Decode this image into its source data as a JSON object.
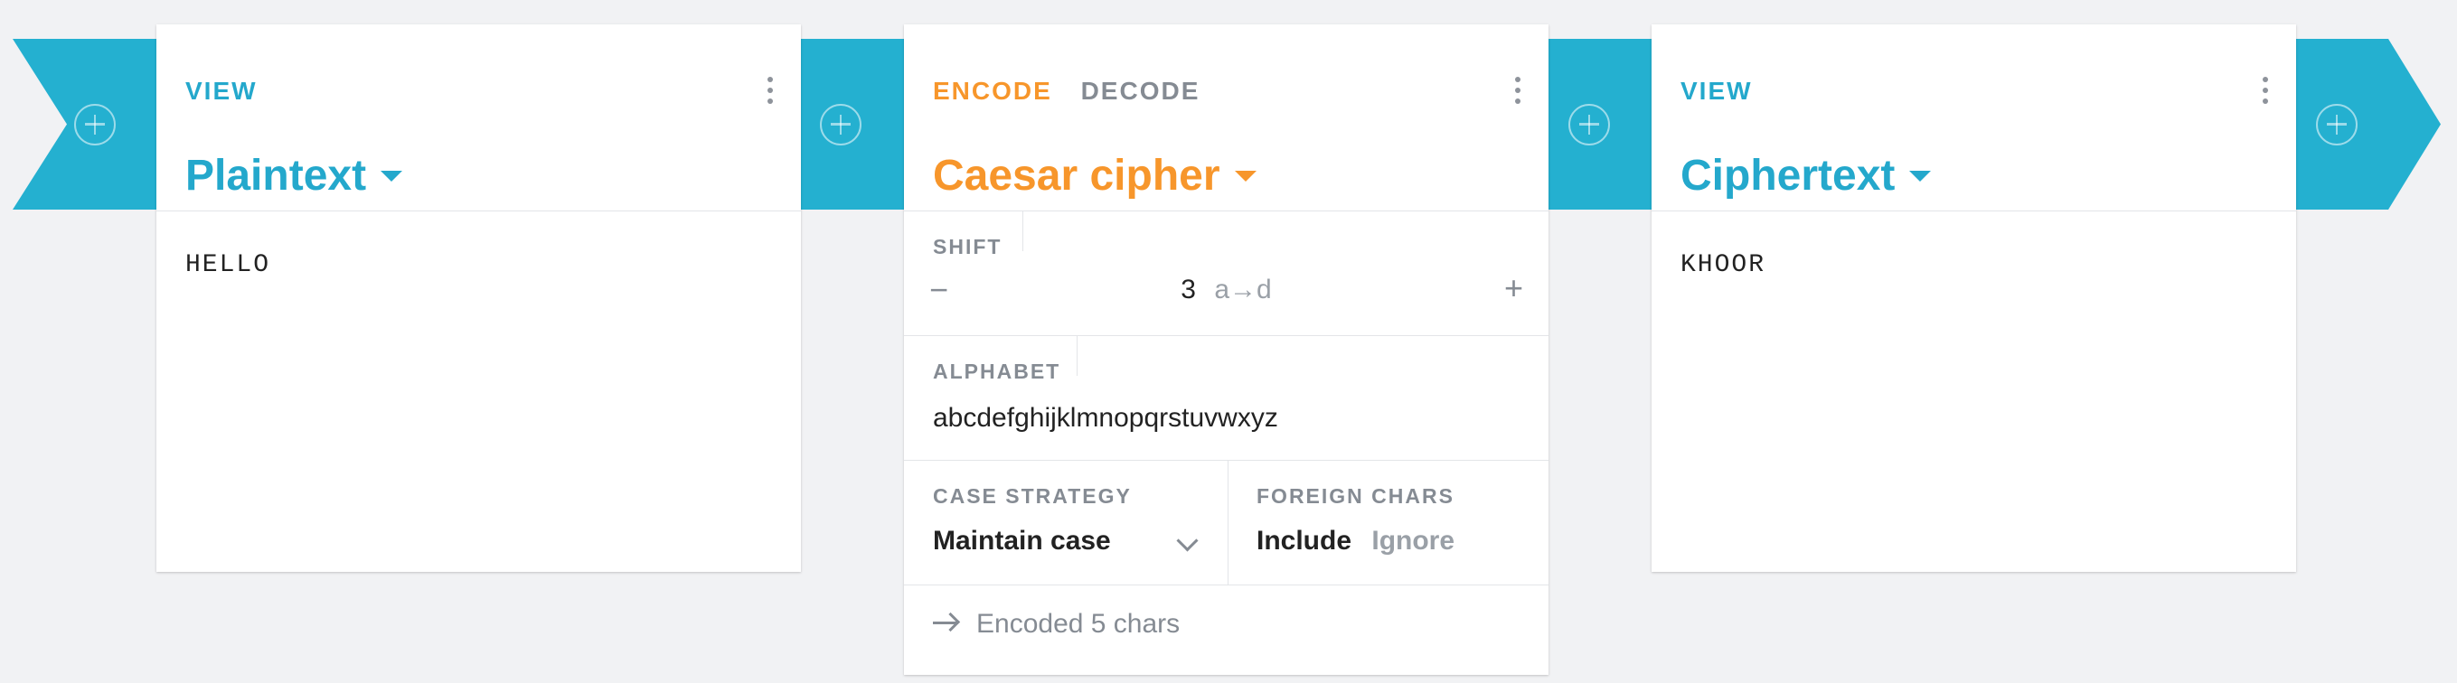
{
  "cards": {
    "left": {
      "tab": "VIEW",
      "title": "Plaintext",
      "content": "HELLO"
    },
    "middle": {
      "tab_encode": "ENCODE",
      "tab_decode": "DECODE",
      "title": "Caesar cipher",
      "shift_label": "SHIFT",
      "shift_minus": "−",
      "shift_value": "3",
      "shift_mapping": "a→d",
      "shift_plus": "+",
      "alphabet_label": "ALPHABET",
      "alphabet_value": "abcdefghijklmnopqrstuvwxyz",
      "case_label": "CASE STRATEGY",
      "case_value": "Maintain case",
      "foreign_label": "FOREIGN CHARS",
      "foreign_include": "Include",
      "foreign_ignore": "Ignore",
      "status": "Encoded 5 chars"
    },
    "right": {
      "tab": "VIEW",
      "title": "Ciphertext",
      "content": "KHOOR"
    }
  },
  "colors": {
    "pipe": "#24b0d0",
    "accent_blue": "#24a8cc",
    "accent_orange": "#f7962b",
    "background": "#f1f2f4"
  },
  "icons": {
    "add": "plus-circle-icon",
    "menu": "vertical-dots-icon",
    "caret": "caret-down-icon",
    "chevron": "chevron-down-icon",
    "arrow": "arrow-right-icon"
  }
}
